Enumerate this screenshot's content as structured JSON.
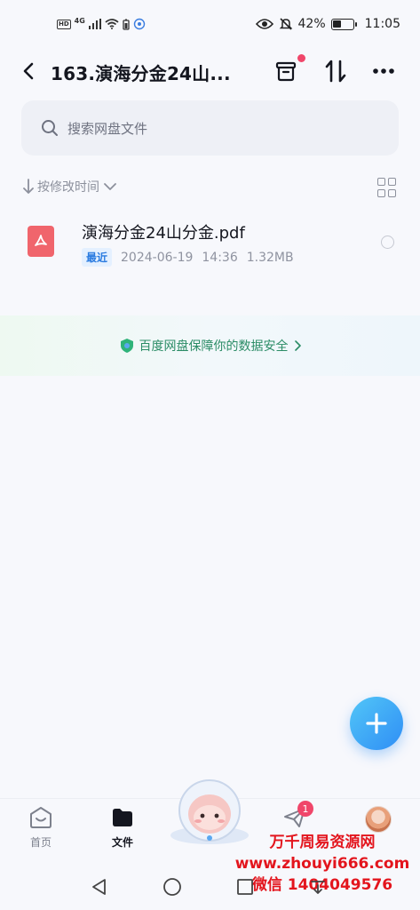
{
  "status_bar": {
    "hd": "HD",
    "network": "4G",
    "battery_percent": "42%",
    "battery_level": 0.42,
    "time": "11:05"
  },
  "header": {
    "title": "163.演海分金24山..."
  },
  "search": {
    "placeholder": "搜索网盘文件"
  },
  "sort": {
    "label": "按修改时间"
  },
  "files": [
    {
      "name": "演海分金24山分金.pdf",
      "badge": "最近",
      "date": "2024-06-19",
      "time": "14:36",
      "size": "1.32MB"
    }
  ],
  "safety": {
    "text": "百度网盘保障你的数据安全"
  },
  "bottom_nav": {
    "home_label": "首页",
    "files_label": "文件",
    "messages_badge": "1"
  },
  "watermark": {
    "line1": "万千周易资源网",
    "line2": "www.zhouyi666.com",
    "line3": "微信 1404049576"
  },
  "colors": {
    "accent": "#2f8ef6",
    "badge_red": "#f0466a",
    "pdf_red": "#f0656c",
    "safety_green": "#2b8c66"
  }
}
